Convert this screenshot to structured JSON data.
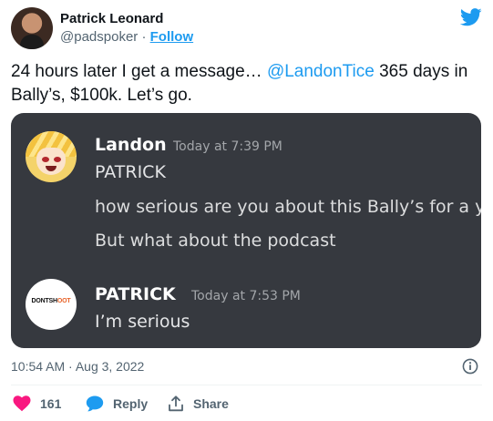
{
  "tweet": {
    "author_name": "Patrick Leonard",
    "handle": "@padspoker",
    "separator": "·",
    "follow_label": "Follow",
    "text_before": "24 hours later I get a message… ",
    "mention": "@LandonTice",
    "text_after": " 365 days in Bally’s, $100k. Let’s go.",
    "timestamp": "10:54 AM · Aug 3, 2022"
  },
  "media": {
    "messages": [
      {
        "username": "Landon",
        "time": "Today at 7:39 PM",
        "lines": [
          "PATRICK",
          "how serious are you about this Bally’s for a y",
          "But what about the podcast"
        ]
      },
      {
        "username": "PATRICK",
        "time": "Today at 7:53 PM",
        "logo_a": "DONTSH",
        "logo_b": "O",
        "logo_c": "OT",
        "lines": [
          "I’m serious"
        ]
      }
    ]
  },
  "actions": {
    "like_count": "161",
    "reply_label": "Reply",
    "share_label": "Share"
  },
  "colors": {
    "accent": "#1d9bf0",
    "like": "#f91880",
    "discord_bg": "#36393f"
  },
  "icons": [
    "twitter-bird-icon",
    "info-icon",
    "heart-icon",
    "reply-bubble-icon",
    "share-icon"
  ]
}
